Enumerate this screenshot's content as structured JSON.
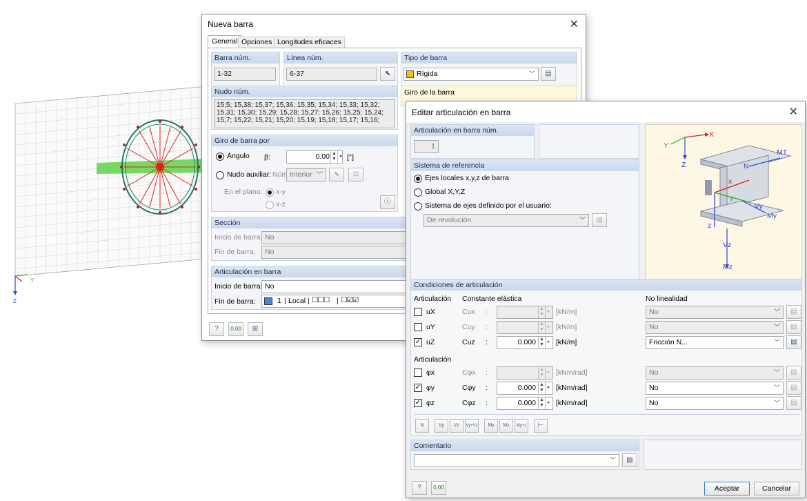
{
  "background_model": {
    "axis_y": "Y",
    "axis_z": "Z"
  },
  "nueva_barra": {
    "title": "Nueva barra",
    "tabs": [
      "General",
      "Opciones",
      "Longitudes eficaces"
    ],
    "barra_num": {
      "label": "Barra núm.",
      "value": "1-32"
    },
    "linea_num": {
      "label": "Línea núm.",
      "value": "6-37"
    },
    "tipo_barra": {
      "label": "Tipo de barra",
      "value": "Rígida",
      "color": "#f5c400"
    },
    "nudo_num": {
      "label": "Nudo núm.",
      "lines": [
        "15,5; 15,38; 15,37; 15,36; 15,35; 15,34; 15,33; 15,32;",
        "15,31; 15,30; 15,29; 15,28; 15,27; 15,26; 15,25; 15,24;",
        "15,7; 15,22; 15,21; 15,20; 15,19; 15,18; 15,17; 15,16;"
      ]
    },
    "giro_de_la_barra": {
      "label": "Giro de la barra"
    },
    "giro_por": {
      "label": "Giro de barra por",
      "angulo": "Ángulo",
      "beta": "β:",
      "beta_value": "0.00",
      "beta_unit": "[°]",
      "nudo_auxiliar": "Nudo auxiliar:",
      "num": "Núm.:",
      "interior": "Interior",
      "en_el_plano": "En el plano:",
      "xy": "x-y",
      "xz": "x-z"
    },
    "seccion": {
      "label": "Sección",
      "inicio": "Inicio de barra:",
      "inicio_value": "No",
      "fin": "Fin de barra:",
      "fin_value": "No"
    },
    "articulacion": {
      "label": "Articulación en barra",
      "inicio": "Inicio de barra:",
      "inicio_value": "No",
      "fin": "Fin de barra:",
      "fin_num": "1",
      "fin_sys": "Local",
      "fin_boxes_1": "☐☐☐",
      "fin_boxes_2": "☐☑☑",
      "fin_color": "#4a86d8"
    },
    "footer_icons": [
      "help-icon",
      "units-icon",
      "info-icon"
    ],
    "units_text": "0.00"
  },
  "editar": {
    "title": "Editar articulación en barra",
    "num": {
      "label": "Articulación en barra núm.",
      "value": "1"
    },
    "sistema": {
      "label": "Sistema de referencia",
      "opt1": "Ejes locales x,y,z de barra",
      "opt2": "Global X,Y,Z",
      "opt3": "Sistema de ejes definido por el usuario:",
      "user_value": "De revolución"
    },
    "preview": {
      "X": "X",
      "Y": "Y",
      "Z": "Z",
      "x": "x",
      "N": "N",
      "MT": "MT",
      "Vy": "Vy",
      "My": "My",
      "Vz": "Vz",
      "Mz": "Mz",
      "y": "y",
      "z": "z"
    },
    "condiciones": {
      "label": "Condiciones de articulación",
      "col_art": "Articulación",
      "col_const": "Constante elástica",
      "col_nolin": "No linealidad",
      "rows": [
        {
          "name": "ux",
          "label": "uX",
          "checked": false,
          "c": "Cux",
          "value": "",
          "unit": "[kN/m]",
          "nonlin": "No"
        },
        {
          "name": "uy",
          "label": "uY",
          "checked": false,
          "c": "Cuy",
          "value": "",
          "unit": "[kN/m]",
          "nonlin": "No"
        },
        {
          "name": "uz",
          "label": "uZ",
          "checked": true,
          "c": "Cuz",
          "value": "0.000",
          "unit": "[kN/m]",
          "nonlin": "Fricción N..."
        }
      ],
      "sub_art": "Articulación",
      "rows2": [
        {
          "name": "phix",
          "label": "φx",
          "checked": false,
          "c": "Cφx",
          "value": "",
          "unit": "[kNm/rad]",
          "nonlin": "No"
        },
        {
          "name": "phiy",
          "label": "φy",
          "checked": true,
          "c": "Cφy",
          "value": "0.000",
          "unit": "[kNm/rad]",
          "nonlin": "No"
        },
        {
          "name": "phiz",
          "label": "φz",
          "checked": true,
          "c": "Cφz",
          "value": "0.000",
          "unit": "[kNm/rad]",
          "nonlin": "No"
        }
      ],
      "preset_labels": [
        "N",
        "Vy",
        "Vz",
        "Vy+Vz",
        "My",
        "Mz",
        "My+z",
        "⊢"
      ]
    },
    "comentario": {
      "label": "Comentario",
      "value": ""
    },
    "aceptar": "Aceptar",
    "cancelar": "Cancelar",
    "units_text": "0.00"
  }
}
